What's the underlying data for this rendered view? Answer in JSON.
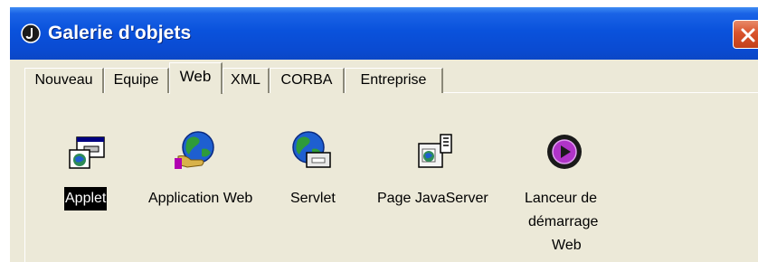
{
  "window": {
    "title": "Galerie d'objets",
    "accent": "#0a52dc",
    "close_color": "#d9532c"
  },
  "tabs": [
    {
      "label": "Nouveau",
      "active": false
    },
    {
      "label": "Equipe",
      "active": false
    },
    {
      "label": "Web",
      "active": true
    },
    {
      "label": "XML",
      "active": false
    },
    {
      "label": "CORBA",
      "active": false
    },
    {
      "label": "Entreprise",
      "active": false
    }
  ],
  "items": [
    {
      "label": "Applet",
      "icon": "applet-icon",
      "selected": true
    },
    {
      "label": "Application Web",
      "icon": "web-application-icon",
      "selected": false
    },
    {
      "label": "Servlet",
      "icon": "servlet-icon",
      "selected": false
    },
    {
      "label": "Page JavaServer",
      "icon": "javaserver-page-icon",
      "selected": false
    },
    {
      "label_lines": [
        "Lanceur de",
        "démarrage",
        "Web"
      ],
      "icon": "web-start-launcher-icon",
      "selected": false
    }
  ]
}
